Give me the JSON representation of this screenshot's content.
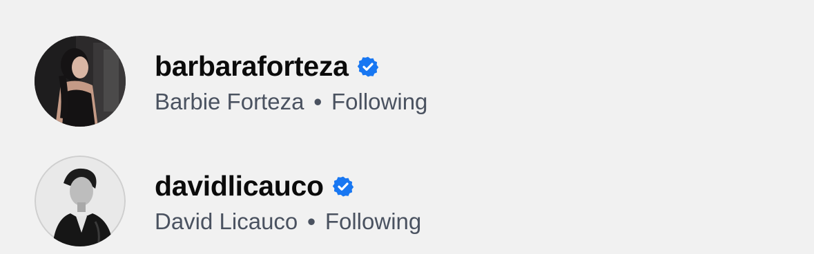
{
  "accounts": [
    {
      "username": "barbaraforteza",
      "display_name": "Barbie Forteza",
      "separator": "•",
      "relationship": "Following",
      "verified_icon": "verified-badge-icon",
      "badge_color": "#1877f2"
    },
    {
      "username": "davidlicauco",
      "display_name": "David Licauco",
      "separator": "•",
      "relationship": "Following",
      "verified_icon": "verified-badge-icon",
      "badge_color": "#1877f2"
    }
  ]
}
